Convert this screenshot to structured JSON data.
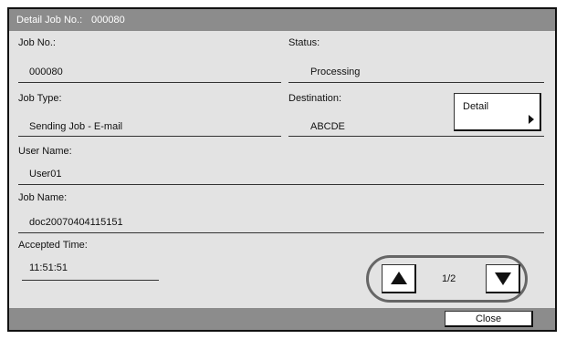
{
  "header": {
    "label": "Detail Job No.:",
    "value": "000080"
  },
  "fields": {
    "job_no": {
      "label": "Job No.:",
      "value": "000080"
    },
    "status": {
      "label": "Status:",
      "value": "Processing"
    },
    "job_type": {
      "label": "Job Type:",
      "value": "Sending Job - E-mail"
    },
    "destination": {
      "label": "Destination:",
      "value": "ABCDE"
    },
    "user_name": {
      "label": "User Name:",
      "value": "User01"
    },
    "job_name": {
      "label": "Job Name:",
      "value": "doc20070404115151"
    },
    "accepted_time": {
      "label": "Accepted Time:",
      "value": "11:51:51"
    }
  },
  "detail_button": {
    "label": "Detail"
  },
  "pager": {
    "page_text": "1/2",
    "up_icon": "up-triangle-icon",
    "down_icon": "down-triangle-icon"
  },
  "footer": {
    "close_label": "Close"
  },
  "colors": {
    "panel_bg": "#e3e3e3",
    "title_bar": "#8c8c8c",
    "button_bg": "#ffffff"
  }
}
